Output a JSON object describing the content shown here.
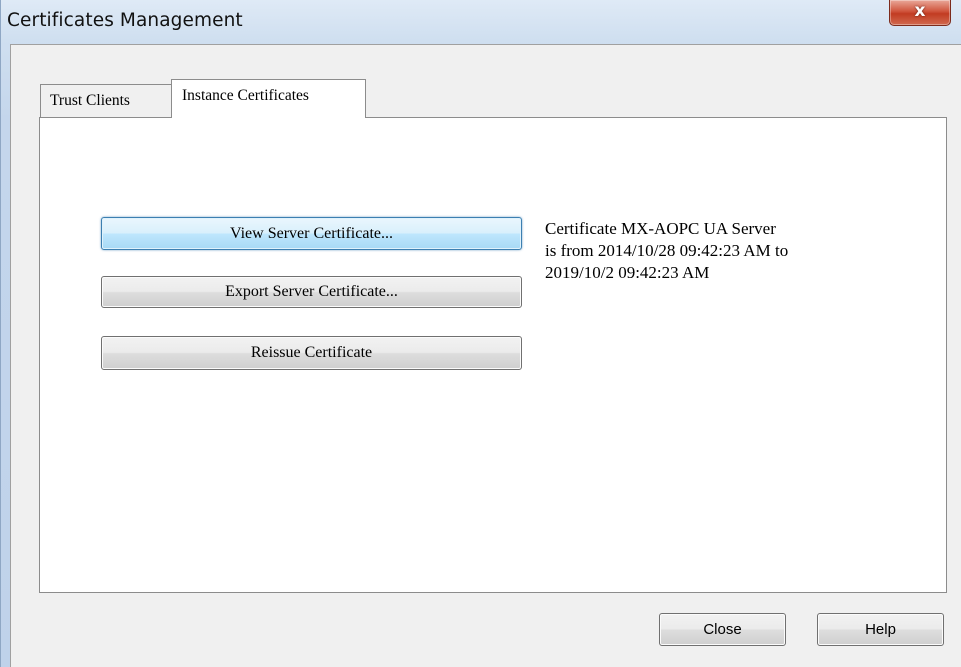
{
  "window": {
    "title": "Certificates Management",
    "close_glyph": "x"
  },
  "tabs": [
    {
      "label": "Trust Clients",
      "active": false
    },
    {
      "label": "Instance Certificates",
      "active": true
    }
  ],
  "panel": {
    "buttons": {
      "view_label": "View Server Certificate...",
      "export_label": "Export Server Certificate...",
      "reissue_label": "Reissue Certificate"
    },
    "certificate_info": {
      "line1": "Certificate MX-AOPC UA Server",
      "line2": "is from 2014/10/28 09:42:23 AM to",
      "line3": "2019/10/2 09:42:23 AM"
    }
  },
  "footer": {
    "close_label": "Close",
    "help_label": "Help"
  },
  "colors": {
    "title_bar": "#c4d6ec",
    "close_button": "#c23c22",
    "focus_border": "#3c7fb1",
    "dialog_background": "#f0f0f0",
    "panel_background": "#ffffff"
  },
  "icons": {
    "close": "close-icon"
  }
}
